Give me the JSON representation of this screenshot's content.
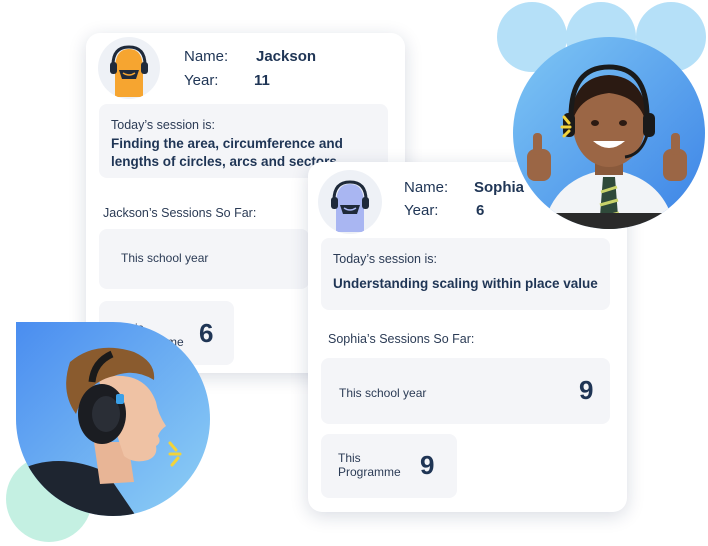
{
  "jackson": {
    "name_label": "Name:",
    "name": "Jackson",
    "year_label": "Year:",
    "year": "11",
    "session_label": "Today’s session is:",
    "session_topic": "Finding the area, circumference and lengths of circles, arcs and sectors",
    "sessions_heading": "Jackson’s Sessions So Far:",
    "school_year_label": "This school year",
    "programme_label": "This Programme",
    "programme_count": "6"
  },
  "sophia": {
    "name_label": "Name:",
    "name": "Sophia",
    "year_label": "Year:",
    "year": "6",
    "session_label": "Today’s session is:",
    "session_topic": "Understanding scaling within place value",
    "sessions_heading": "Sophia’s Sessions So Far:",
    "school_year_label": "This school year",
    "school_year_count": "9",
    "programme_label_line1": "This",
    "programme_label_line2": "Programme",
    "programme_count": "9"
  },
  "colors": {
    "text": "#1f3555",
    "jackson_avatar": "#f6a530",
    "sophia_avatar": "#a9b6f2",
    "blue_blob": "#a9dcf7",
    "green_blob": "#bfeee0",
    "photo_gradient": "#3b82e6"
  },
  "icons": [
    "headset-avatar-icon",
    "sparkle-icon"
  ]
}
